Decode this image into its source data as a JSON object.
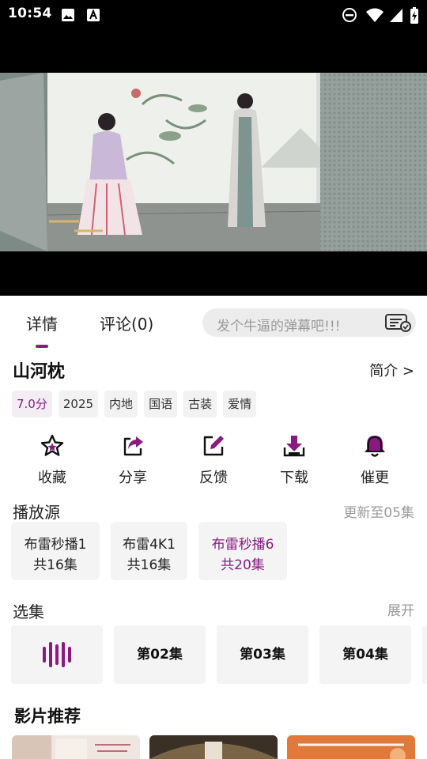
{
  "status_bar": {
    "time": "10:54"
  },
  "tabs": [
    {
      "label": "详情"
    },
    {
      "label": "评论(0)"
    }
  ],
  "danmaku": {
    "placeholder": "发个牛逼的弹幕吧!!!"
  },
  "show": {
    "title": "山河枕",
    "intro_link": "简介 >",
    "tags": [
      "7.0分",
      "2025",
      "内地",
      "国语",
      "古装",
      "爱情"
    ]
  },
  "actions": [
    {
      "label": "收藏",
      "icon": "star-icon"
    },
    {
      "label": "分享",
      "icon": "share-icon"
    },
    {
      "label": "反馈",
      "icon": "edit-icon"
    },
    {
      "label": "下载",
      "icon": "download-icon"
    },
    {
      "label": "催更",
      "icon": "bell-icon"
    }
  ],
  "sources": {
    "title": "播放源",
    "update_status": "更新至05集",
    "items": [
      {
        "name": "布雷秒播1",
        "count": "共16集"
      },
      {
        "name": "布雷4K1",
        "count": "共16集"
      },
      {
        "name": "布雷秒播6",
        "count": "共20集"
      }
    ]
  },
  "episodes": {
    "title": "选集",
    "expand": "展开",
    "items": [
      "第02集",
      "第03集",
      "第04集"
    ]
  },
  "recommend": {
    "title": "影片推荐"
  },
  "colors": {
    "accent": "#8a1a82",
    "muted": "#9a9a9a",
    "card_bg": "#f4f4f4"
  }
}
